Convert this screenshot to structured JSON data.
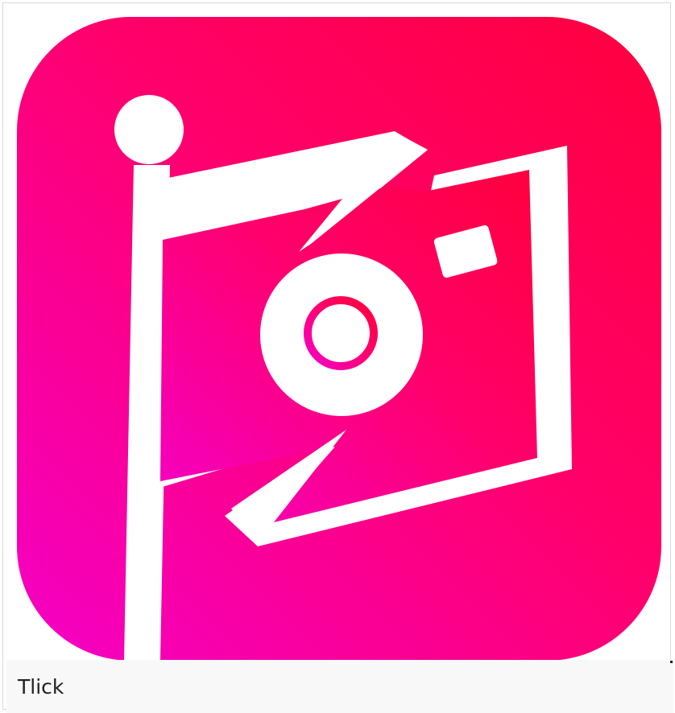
{
  "caption": {
    "text": "Tlick"
  },
  "icon": {
    "semantic_name": "flag-camera-app-icon",
    "gradient_colors": [
      "#ff003d",
      "#ff006c",
      "#f400c7"
    ],
    "foreground_color": "#ffffff"
  }
}
